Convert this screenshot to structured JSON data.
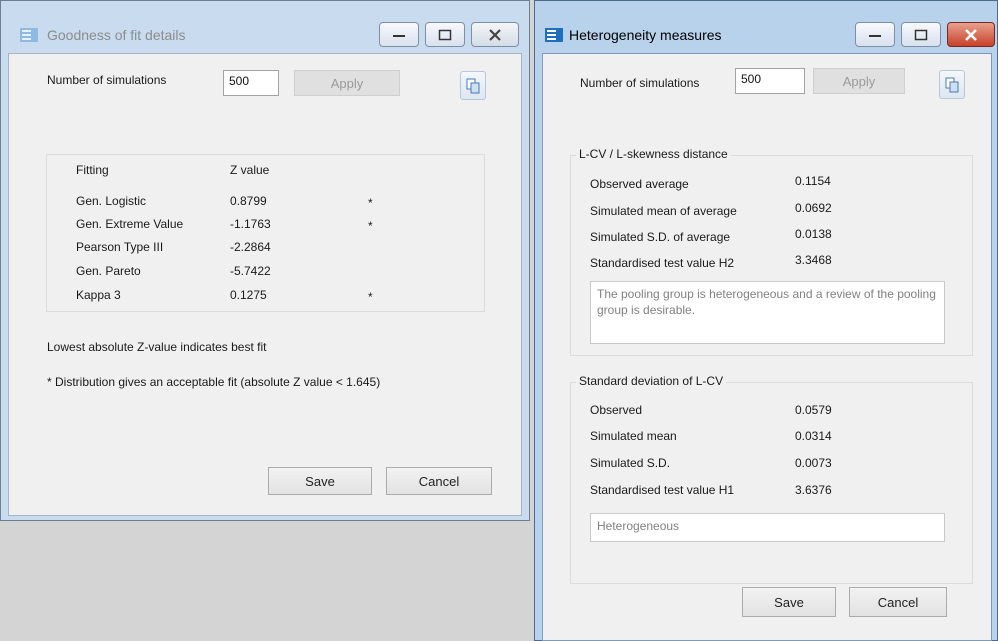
{
  "goodness_window": {
    "title": "Goodness of fit details",
    "num_sim_label": "Number of simulations",
    "num_sim_value": "500",
    "apply_label": "Apply",
    "fitting_header": "Fitting",
    "z_header": "Z value",
    "rows": [
      {
        "name": "Gen. Logistic",
        "z": "0.8799",
        "mark": "*"
      },
      {
        "name": "Gen. Extreme Value",
        "z": "-1.1763",
        "mark": "*"
      },
      {
        "name": "Pearson Type III",
        "z": "-2.2864",
        "mark": ""
      },
      {
        "name": "Gen. Pareto",
        "z": "-5.7422",
        "mark": ""
      },
      {
        "name": "Kappa 3",
        "z": "0.1275",
        "mark": "*"
      }
    ],
    "note1": "Lowest absolute Z-value indicates best fit",
    "note2": "* Distribution gives an acceptable fit (absolute Z value < 1.645)",
    "save_label": "Save",
    "cancel_label": "Cancel"
  },
  "heterogeneity_window": {
    "title": "Heterogeneity measures",
    "num_sim_label": "Number of simulations",
    "num_sim_value": "500",
    "apply_label": "Apply",
    "group1": {
      "title": "L-CV / L-skewness distance",
      "rows": [
        {
          "label": "Observed average",
          "value": "0.1154"
        },
        {
          "label": "Simulated mean of average",
          "value": "0.0692"
        },
        {
          "label": "Simulated S.D. of average",
          "value": "0.0138"
        },
        {
          "label": "Standardised test value H2",
          "value": "3.3468"
        }
      ],
      "message": "The pooling group is heterogeneous and a review of the pooling group is desirable."
    },
    "group2": {
      "title": "Standard deviation of L-CV",
      "rows": [
        {
          "label": "Observed",
          "value": "0.0579"
        },
        {
          "label": "Simulated mean",
          "value": "0.0314"
        },
        {
          "label": "Simulated S.D.",
          "value": "0.0073"
        },
        {
          "label": "Standardised test value H1",
          "value": "3.6376"
        }
      ],
      "message": "Heterogeneous"
    },
    "save_label": "Save",
    "cancel_label": "Cancel"
  },
  "colors": {
    "titlebar_active": "#b8d2ec",
    "titlebar_inactive": "#c9dbee",
    "close_active": "#c7422a",
    "client_bg": "#f0f0f0"
  }
}
